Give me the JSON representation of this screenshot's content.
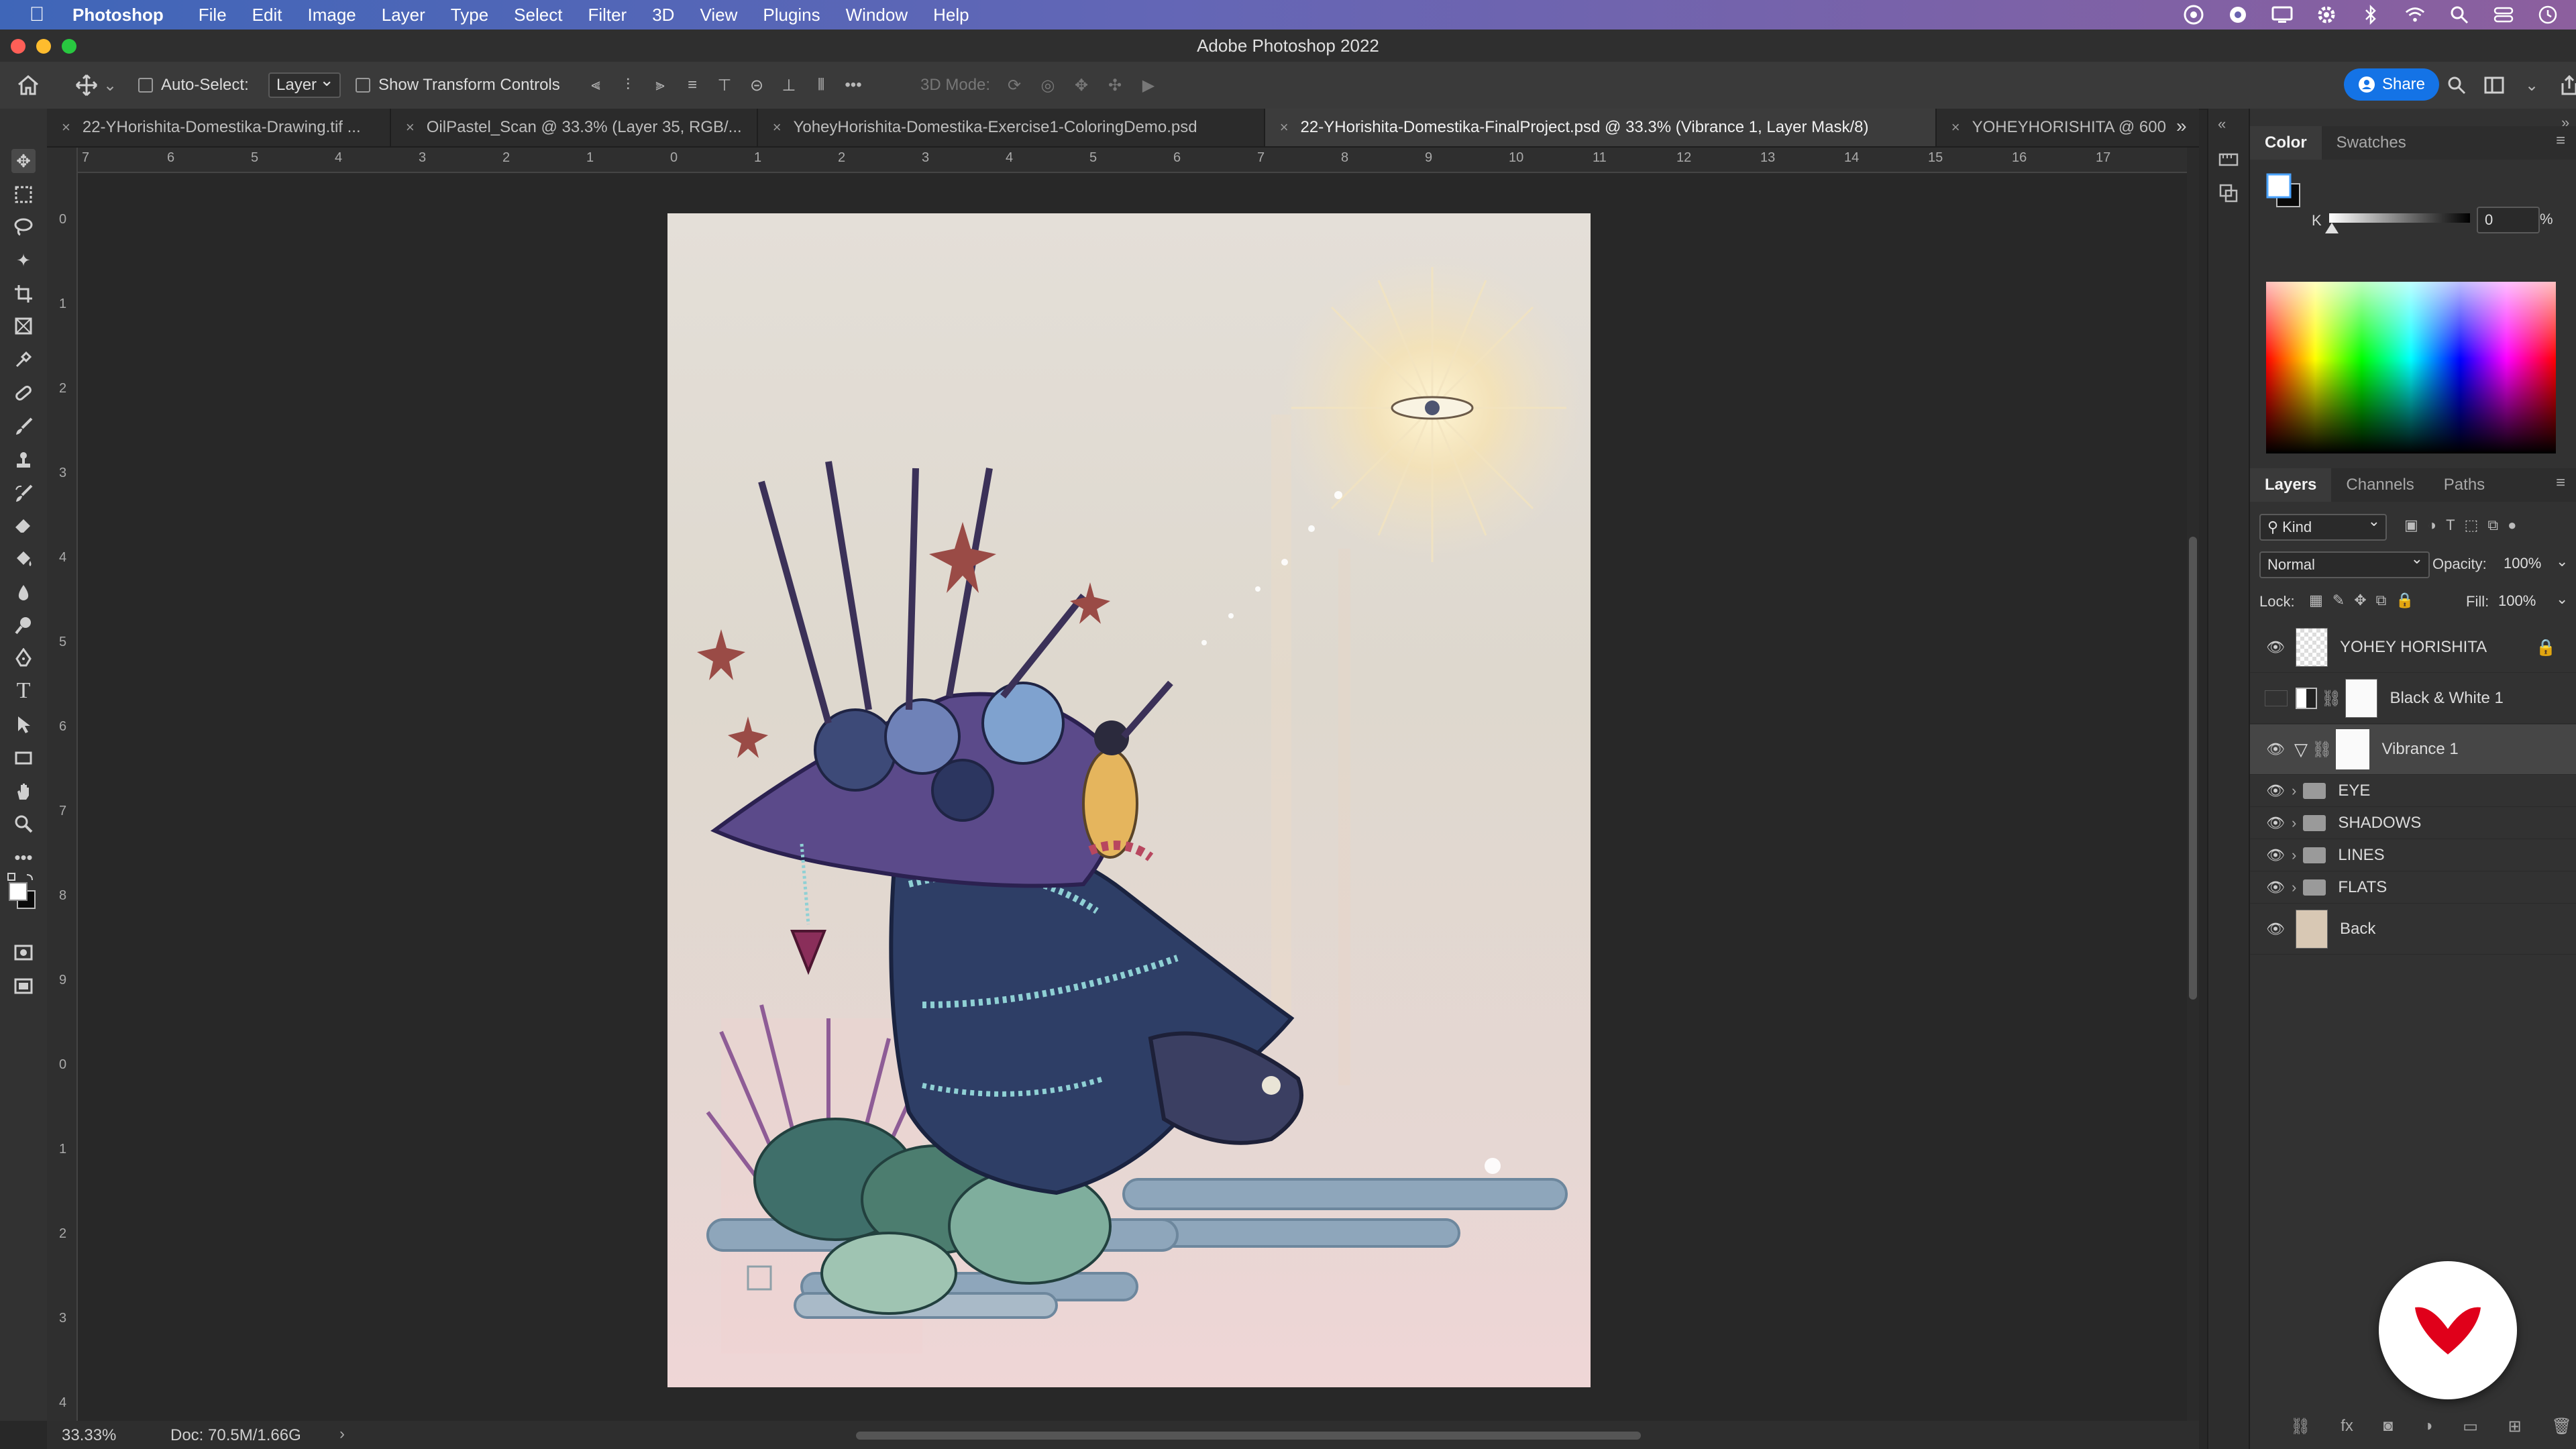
{
  "menubar": {
    "app_name": "Photoshop",
    "items": [
      "File",
      "Edit",
      "Image",
      "Layer",
      "Type",
      "Select",
      "Filter",
      "3D",
      "View",
      "Plugins",
      "Window",
      "Help"
    ]
  },
  "window": {
    "title": "Adobe Photoshop 2022"
  },
  "options": {
    "auto_select_label": "Auto-Select:",
    "auto_select_value": "Layer",
    "transform_controls_label": "Show Transform Controls",
    "mode_3d_label": "3D Mode:",
    "share_label": "Share"
  },
  "tabs": [
    {
      "label": "22-YHorishita-Domestika-Drawing.tif ...",
      "active": false
    },
    {
      "label": "OilPastel_Scan @ 33.3% (Layer 35, RGB/...",
      "active": false
    },
    {
      "label": "YoheyHorishita-Domestika-Exercise1-ColoringDemo.psd",
      "active": false
    },
    {
      "label": "22-YHorishita-Domestika-FinalProject.psd @ 33.3% (Vibrance 1, Layer Mask/8)",
      "active": true
    },
    {
      "label": "YOHEYHORISHITA @ 600",
      "active": false
    }
  ],
  "ruler": {
    "h": [
      "7",
      "6",
      "5",
      "4",
      "3",
      "2",
      "1",
      "0",
      "1",
      "2",
      "3",
      "4",
      "5",
      "6",
      "7",
      "8",
      "9",
      "10",
      "11",
      "12",
      "13",
      "14",
      "15",
      "16",
      "17"
    ],
    "v": [
      "0",
      "1",
      "2",
      "3",
      "4",
      "5",
      "6",
      "7",
      "8",
      "9",
      "0",
      "1",
      "2",
      "3",
      "4"
    ]
  },
  "status": {
    "zoom": "33.33%",
    "doc": "Doc: 70.5M/1.66G",
    "arrow": "›"
  },
  "color_panel": {
    "tabs": [
      "Color",
      "Swatches"
    ],
    "slider_label": "K",
    "value": "0",
    "unit": "%"
  },
  "layers_panel": {
    "tabs": [
      "Layers",
      "Channels",
      "Paths"
    ],
    "filter": "Kind",
    "blend_mode": "Normal",
    "opacity_label": "Opacity:",
    "opacity": "100%",
    "lock_label": "Lock:",
    "fill_label": "Fill:",
    "fill": "100%",
    "layers": [
      {
        "name": "YOHEY HORISHITA",
        "kind": "pixel",
        "visible": true,
        "locked": true
      },
      {
        "name": "Black & White 1",
        "kind": "adjustment",
        "visible": false
      },
      {
        "name": "Vibrance 1",
        "kind": "adjustment",
        "visible": true,
        "selected": true
      },
      {
        "name": "EYE",
        "kind": "group",
        "visible": true
      },
      {
        "name": "SHADOWS",
        "kind": "group",
        "visible": true
      },
      {
        "name": "LINES",
        "kind": "group",
        "visible": true
      },
      {
        "name": "FLATS",
        "kind": "group",
        "visible": true
      },
      {
        "name": "Back",
        "kind": "pixel",
        "visible": true
      }
    ]
  },
  "colors": {
    "accent": "#1473e6",
    "brand": "#e0001a",
    "menubar_start": "#3f66b8",
    "menubar_end": "#8c5f9e"
  }
}
